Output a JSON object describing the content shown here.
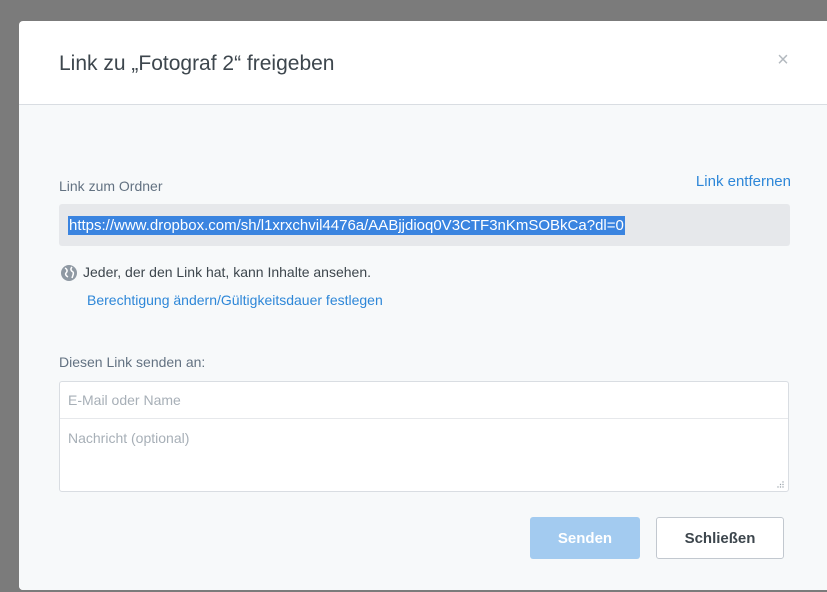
{
  "dialog": {
    "title": "Link zu „Fotograf 2“ freigeben",
    "close_glyph": "×"
  },
  "link_section": {
    "label": "Link zum Ordner",
    "remove_label": "Link entfernen",
    "url": "https://www.dropbox.com/sh/l1xrxchvil4476a/AABjjdioq0V3CTF3nKmSOBkCa?dl=0"
  },
  "access": {
    "text": "Jeder, der den Link hat, kann Inhalte ansehen.",
    "permissions_link": "Berechtigung ändern/Gültigkeitsdauer festlegen"
  },
  "send_section": {
    "label": "Diesen Link senden an:",
    "email_placeholder": "E-Mail oder Name",
    "message_placeholder": "Nachricht (optional)"
  },
  "buttons": {
    "send_label": "Senden",
    "close_label": "Schließen"
  },
  "colors": {
    "accent": "#2e87d8",
    "send_button_disabled": "#a3cbf0",
    "selection": "#3a84e0"
  },
  "icons": {
    "globe": "globe-icon",
    "close": "close-icon",
    "resize": "resize-handle-icon"
  }
}
